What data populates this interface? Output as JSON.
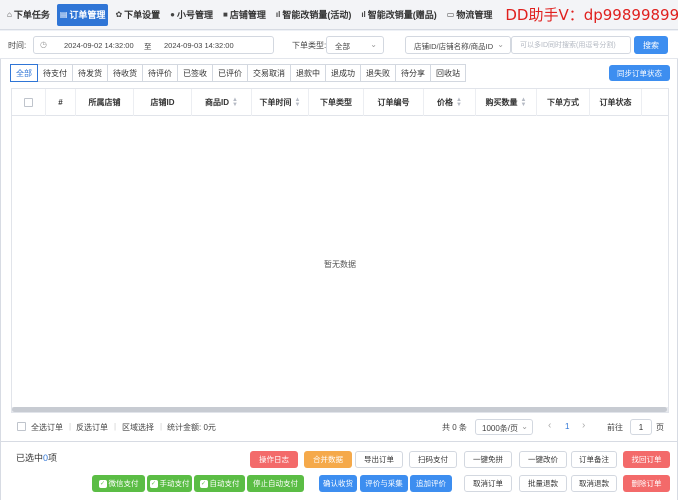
{
  "tabs": [
    {
      "label": "下单任务",
      "icon": "home-icon",
      "glyph": "⌂"
    },
    {
      "label": "订单管理",
      "icon": "order-icon",
      "glyph": "▤",
      "active": true
    },
    {
      "label": "下单设置",
      "icon": "gear-icon",
      "glyph": "✿"
    },
    {
      "label": "小号管理",
      "icon": "user-icon",
      "glyph": "●"
    },
    {
      "label": "店铺管理",
      "icon": "shop-icon",
      "glyph": "■"
    },
    {
      "label": "智能改销量(活动)",
      "icon": "bar-chart-icon",
      "glyph": "ıl"
    },
    {
      "label": "智能改销量(赠品)",
      "icon": "bar-chart-icon",
      "glyph": "ıl"
    },
    {
      "label": "物流管理",
      "icon": "truck-icon",
      "glyph": "▭"
    }
  ],
  "promo": "DD助手V：dp99899899",
  "filter": {
    "time_label": "时间:",
    "date_start": "2024-09-02 14:32:00",
    "date_sep": "至",
    "date_end": "2024-09-03 14:32:00",
    "type_label": "下单类型:",
    "type_value": "全部",
    "field_value": "店铺ID/店铺名称/商品ID",
    "search_placeholder": "可以多ID同时搜索(用逗号分割)",
    "search_button": "搜索"
  },
  "status_tabs": [
    "全部",
    "待支付",
    "待发货",
    "待收货",
    "待评价",
    "已签收",
    "已评价",
    "交易取消",
    "退款中",
    "退成功",
    "退失败",
    "待分享",
    "回收站"
  ],
  "sync_button": "同步订单状态",
  "columns": [
    {
      "label": "",
      "sortable": false,
      "checkbox": true
    },
    {
      "label": "#",
      "sortable": false
    },
    {
      "label": "所属店铺",
      "sortable": false
    },
    {
      "label": "店铺ID",
      "sortable": false
    },
    {
      "label": "商品ID",
      "sortable": true
    },
    {
      "label": "下单时间",
      "sortable": true
    },
    {
      "label": "下单类型",
      "sortable": false
    },
    {
      "label": "订单编号",
      "sortable": false
    },
    {
      "label": "价格",
      "sortable": true
    },
    {
      "label": "购买数量",
      "sortable": true
    },
    {
      "label": "下单方式",
      "sortable": false
    },
    {
      "label": "订单状态",
      "sortable": false
    }
  ],
  "empty_text": "暂无数据",
  "footer": {
    "select_all": "全选订单",
    "invert": "反选订单",
    "range": "区域选择",
    "stats": "统计金额: 0元",
    "total": "共 0 条",
    "page_size": "1000条/页",
    "prev": "‹",
    "current_page": "1",
    "next": "›",
    "goto_label": "前往",
    "goto_value": "1",
    "page_unit": "页"
  },
  "selected": {
    "prefix": "已选中",
    "count": "0",
    "suffix": "项"
  },
  "actions_row1": [
    {
      "label": "操作日志",
      "style": "red"
    },
    {
      "label": "合并数据",
      "style": "orange"
    },
    {
      "label": "导出订单",
      "style": "white"
    },
    {
      "label": "扫码支付",
      "style": "white"
    },
    {
      "label": "一键免拼",
      "style": "white"
    },
    {
      "label": "一键改价",
      "style": "white"
    },
    {
      "label": "订单备注",
      "style": "white"
    },
    {
      "label": "找回订单",
      "style": "red"
    }
  ],
  "actions_row2": [
    {
      "label": "微信支付",
      "style": "green",
      "icon": "wechat-icon"
    },
    {
      "label": "手动支付",
      "style": "green",
      "icon": "hand-icon"
    },
    {
      "label": "自动支付",
      "style": "green",
      "icon": "auto-icon"
    },
    {
      "label": "停止自动支付",
      "style": "green"
    },
    {
      "label": "确认收货",
      "style": "blue"
    },
    {
      "label": "评价与采集",
      "style": "blue"
    },
    {
      "label": "追加评价",
      "style": "blue"
    },
    {
      "label": "取消订单",
      "style": "white"
    },
    {
      "label": "批量退款",
      "style": "white"
    },
    {
      "label": "取消退款",
      "style": "white"
    },
    {
      "label": "删除订单",
      "style": "red"
    }
  ],
  "colors": {
    "primary": "#2f75d6",
    "button_blue": "#3d8ef0",
    "danger": "#f36a6a",
    "warning": "#f5a94a",
    "success": "#5bbd45",
    "promo": "#e0201e"
  }
}
